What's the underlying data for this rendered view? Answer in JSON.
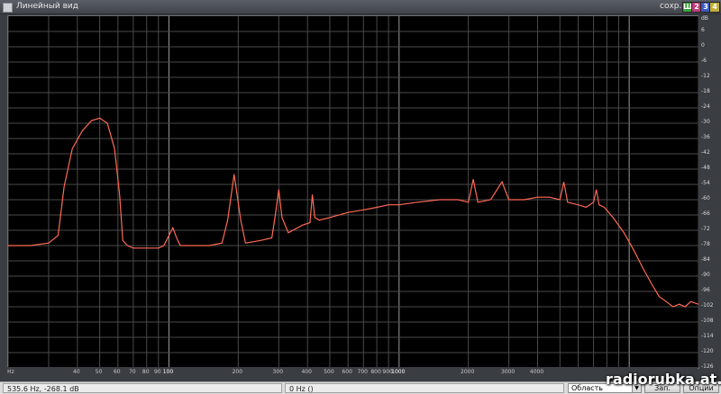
{
  "window": {
    "title": "Линейный вид",
    "save_label": "сохр.",
    "channel_buttons": [
      {
        "label": "Ш",
        "color": "#3aa33a"
      },
      {
        "label": "2",
        "color": "#c03a7a"
      },
      {
        "label": "3",
        "color": "#3a5ac0"
      },
      {
        "label": "4",
        "color": "#c0b03a"
      }
    ]
  },
  "chart_data": {
    "type": "line",
    "title": "",
    "xlabel": "Hz",
    "ylabel": "dB",
    "x_scale": "log",
    "xlim": [
      20,
      20000
    ],
    "ylim": [
      -126,
      12
    ],
    "x_ticks": [
      "Hz",
      "40",
      "50",
      "60",
      "70",
      "80",
      "90",
      "100",
      "200",
      "300",
      "400",
      "500",
      "600",
      "700",
      "800",
      "900",
      "1000",
      "2000",
      "3000",
      "4000"
    ],
    "y_ticks": [
      "dB",
      "6",
      "0",
      "-6",
      "-12",
      "-18",
      "-24",
      "-30",
      "-36",
      "-42",
      "-48",
      "-54",
      "-60",
      "-66",
      "-72",
      "-78",
      "-84",
      "-90",
      "-96",
      "-102",
      "-108",
      "-114",
      "-120",
      "-126"
    ],
    "grid": true,
    "line_color": "#ff6a55",
    "series": [
      {
        "values": [
          [
            20,
            -78
          ],
          [
            25,
            -78
          ],
          [
            30,
            -77
          ],
          [
            33,
            -74
          ],
          [
            35,
            -55
          ],
          [
            38,
            -40
          ],
          [
            42,
            -33
          ],
          [
            46,
            -29
          ],
          [
            50,
            -28
          ],
          [
            54,
            -30
          ],
          [
            58,
            -40
          ],
          [
            61,
            -58
          ],
          [
            63,
            -76
          ],
          [
            66,
            -78
          ],
          [
            70,
            -79
          ],
          [
            80,
            -79
          ],
          [
            90,
            -79
          ],
          [
            95,
            -78
          ],
          [
            100,
            -74
          ],
          [
            104,
            -71
          ],
          [
            108,
            -75
          ],
          [
            112,
            -78
          ],
          [
            130,
            -78
          ],
          [
            150,
            -78
          ],
          [
            170,
            -77
          ],
          [
            180,
            -68
          ],
          [
            192,
            -50
          ],
          [
            205,
            -68
          ],
          [
            215,
            -77
          ],
          [
            250,
            -76
          ],
          [
            280,
            -75
          ],
          [
            290,
            -66
          ],
          [
            300,
            -56
          ],
          [
            310,
            -67
          ],
          [
            330,
            -73
          ],
          [
            380,
            -70
          ],
          [
            410,
            -69
          ],
          [
            420,
            -58
          ],
          [
            430,
            -67
          ],
          [
            450,
            -68
          ],
          [
            500,
            -67
          ],
          [
            600,
            -65
          ],
          [
            700,
            -64
          ],
          [
            800,
            -63
          ],
          [
            900,
            -62
          ],
          [
            1000,
            -62
          ],
          [
            1200,
            -61
          ],
          [
            1500,
            -60
          ],
          [
            1800,
            -60
          ],
          [
            2000,
            -61
          ],
          [
            2100,
            -52
          ],
          [
            2200,
            -61
          ],
          [
            2500,
            -60
          ],
          [
            2800,
            -53
          ],
          [
            3000,
            -60
          ],
          [
            3500,
            -60
          ],
          [
            4000,
            -59
          ],
          [
            4500,
            -59
          ],
          [
            5000,
            -60
          ],
          [
            5200,
            -53
          ],
          [
            5400,
            -61
          ],
          [
            6000,
            -62
          ],
          [
            6500,
            -63
          ],
          [
            7000,
            -61
          ],
          [
            7200,
            -56
          ],
          [
            7400,
            -62
          ],
          [
            7800,
            -63
          ],
          [
            8500,
            -67
          ],
          [
            9500,
            -73
          ],
          [
            10500,
            -80
          ],
          [
            11500,
            -87
          ],
          [
            12500,
            -93
          ],
          [
            13500,
            -98
          ],
          [
            14500,
            -100
          ],
          [
            15500,
            -102
          ],
          [
            16500,
            -101
          ],
          [
            17500,
            -102
          ],
          [
            18500,
            -100
          ],
          [
            20000,
            -101
          ]
        ]
      }
    ]
  },
  "status": {
    "cursor_readout": "535.6 Hz, -268.1 dB",
    "frequency_readout": "0 Hz ()",
    "region_select": "Область",
    "buttons": [
      "Зап.",
      "Опции"
    ]
  },
  "watermark": "radiorubka.at.ua"
}
